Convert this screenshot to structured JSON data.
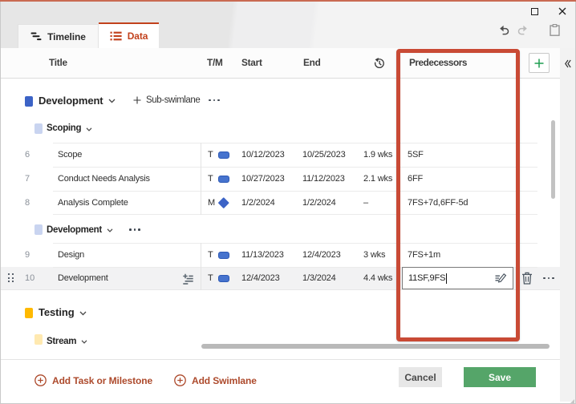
{
  "window": {
    "accent_line_color": "#c96a52",
    "controls": {
      "maximize_icon": "maximize-square",
      "close_icon": "close-x"
    }
  },
  "tabs": [
    {
      "label": "Timeline",
      "icon": "gantt-bars-icon",
      "active": false
    },
    {
      "label": "Data",
      "icon": "bullet-list-icon",
      "active": true
    }
  ],
  "toolbar": {
    "icons": [
      "undo-icon",
      "redo-icon",
      "clipboard-icon"
    ]
  },
  "grid": {
    "columns": {
      "title": "Title",
      "tm": "T/M",
      "start": "Start",
      "end": "End",
      "duration_icon": "history-clock-icon",
      "predecessors": "Predecessors"
    },
    "add_column_icon": "plus-icon",
    "collapse_icon": "double-chevron-left-icon",
    "swimlane1": {
      "title": "Development",
      "color": "#3c63c6",
      "add_sub_label": "Sub-swimlane"
    },
    "sub1": {
      "title": "Scoping",
      "color": "#c9d4f0"
    },
    "sub2": {
      "title": "Development",
      "color": "#c9d4f0"
    },
    "swimlane2": {
      "title": "Testing",
      "color": "#ffb900"
    },
    "sub3": {
      "title": "Stream",
      "color": "#ffe9b0"
    },
    "tasks": [
      {
        "num": "6",
        "title": "Scope",
        "type": "T",
        "start": "10/12/2023",
        "end": "10/25/2023",
        "duration": "1.9 wks",
        "predecessors": "5SF"
      },
      {
        "num": "7",
        "title": "Conduct Needs Analysis",
        "type": "T",
        "start": "10/27/2023",
        "end": "11/12/2023",
        "duration": "2.1 wks",
        "predecessors": "6FF"
      },
      {
        "num": "8",
        "title": "Analysis Complete",
        "type": "M",
        "start": "1/2/2024",
        "end": "1/2/2024",
        "duration": "–",
        "predecessors": "7FS+7d,6FF-5d"
      },
      {
        "num": "9",
        "title": "Design",
        "type": "T",
        "start": "11/13/2023",
        "end": "12/4/2023",
        "duration": "3 wks",
        "predecessors": "7FS+1m"
      },
      {
        "num": "10",
        "title": "Development",
        "type": "T",
        "start": "12/4/2023",
        "end": "1/3/2024",
        "duration": "4.4 wks",
        "predecessors": ""
      }
    ],
    "editing": {
      "value": "11SF,9FS"
    }
  },
  "footer": {
    "add_task": "Add Task or Milestone",
    "add_swimlane": "Add Swimlane",
    "cancel": "Cancel",
    "save": "Save"
  },
  "annotation": {
    "shape": "rectangle",
    "color": "#c94a35",
    "target": "Predecessors column"
  }
}
